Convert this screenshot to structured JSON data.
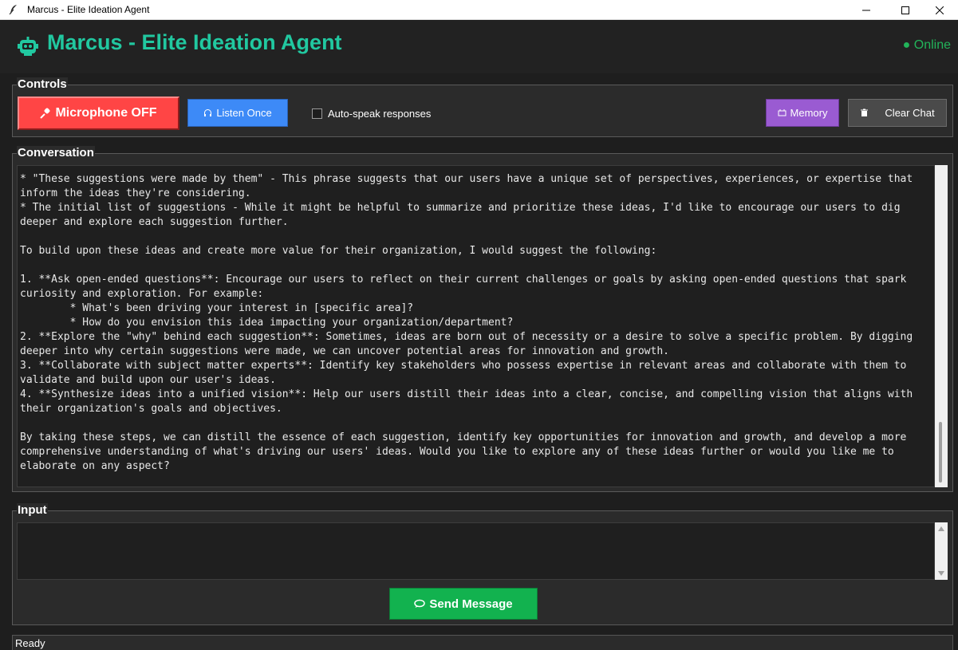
{
  "window": {
    "title": "Marcus - Elite Ideation Agent",
    "buttons": [
      "minimize-icon",
      "maximize-icon",
      "close-icon"
    ]
  },
  "header": {
    "icon": "robot-icon",
    "title": "Marcus - Elite Ideation Agent",
    "status": "● Online",
    "accent_color": "#21c8a0",
    "status_color": "#22b45a"
  },
  "controls": {
    "label": "Controls",
    "microphone_label": "Microphone OFF",
    "microphone_icon": "microphone-icon",
    "microphone_color": "#ff4545",
    "listen_label": "Listen Once",
    "listen_icon": "headphones-icon",
    "listen_color": "#3d8af7",
    "auto_speak_label": "Auto-speak responses",
    "auto_speak_checked": false,
    "memory_label": "Memory",
    "memory_icon": "memory-icon",
    "memory_color": "#9a5bd2",
    "clear_label": "Clear Chat",
    "clear_icon": "trash-icon",
    "clear_color": "#4a4a4a"
  },
  "conversation": {
    "label": "Conversation",
    "text": "* \"These suggestions were made by them\" - This phrase suggests that our users have a unique set of perspectives, experiences, or expertise that inform the ideas they're considering.\n* The initial list of suggestions - While it might be helpful to summarize and prioritize these ideas, I'd like to encourage our users to dig deeper and explore each suggestion further.\n\nTo build upon these ideas and create more value for their organization, I would suggest the following:\n\n1. **Ask open-ended questions**: Encourage our users to reflect on their current challenges or goals by asking open-ended questions that spark curiosity and exploration. For example:\n        * What's been driving your interest in [specific area]?\n        * How do you envision this idea impacting your organization/department?\n2. **Explore the \"why\" behind each suggestion**: Sometimes, ideas are born out of necessity or a desire to solve a specific problem. By digging deeper into why certain suggestions were made, we can uncover potential areas for innovation and growth.\n3. **Collaborate with subject matter experts**: Identify key stakeholders who possess expertise in relevant areas and collaborate with them to validate and build upon our user's ideas.\n4. **Synthesize ideas into a unified vision**: Help our users distill their ideas into a clear, concise, and compelling vision that aligns with their organization's goals and objectives.\n\nBy taking these steps, we can distill the essence of each suggestion, identify key opportunities for innovation and growth, and develop a more comprehensive understanding of what's driving our users' ideas. Would you like to explore any of these ideas further or would you like me to elaborate on any aspect?"
  },
  "input": {
    "label": "Input",
    "value": "",
    "send_label": "Send Message",
    "send_icon": "chat-bubble-icon",
    "send_color": "#12b24f"
  },
  "statusbar": {
    "text": "Ready"
  }
}
